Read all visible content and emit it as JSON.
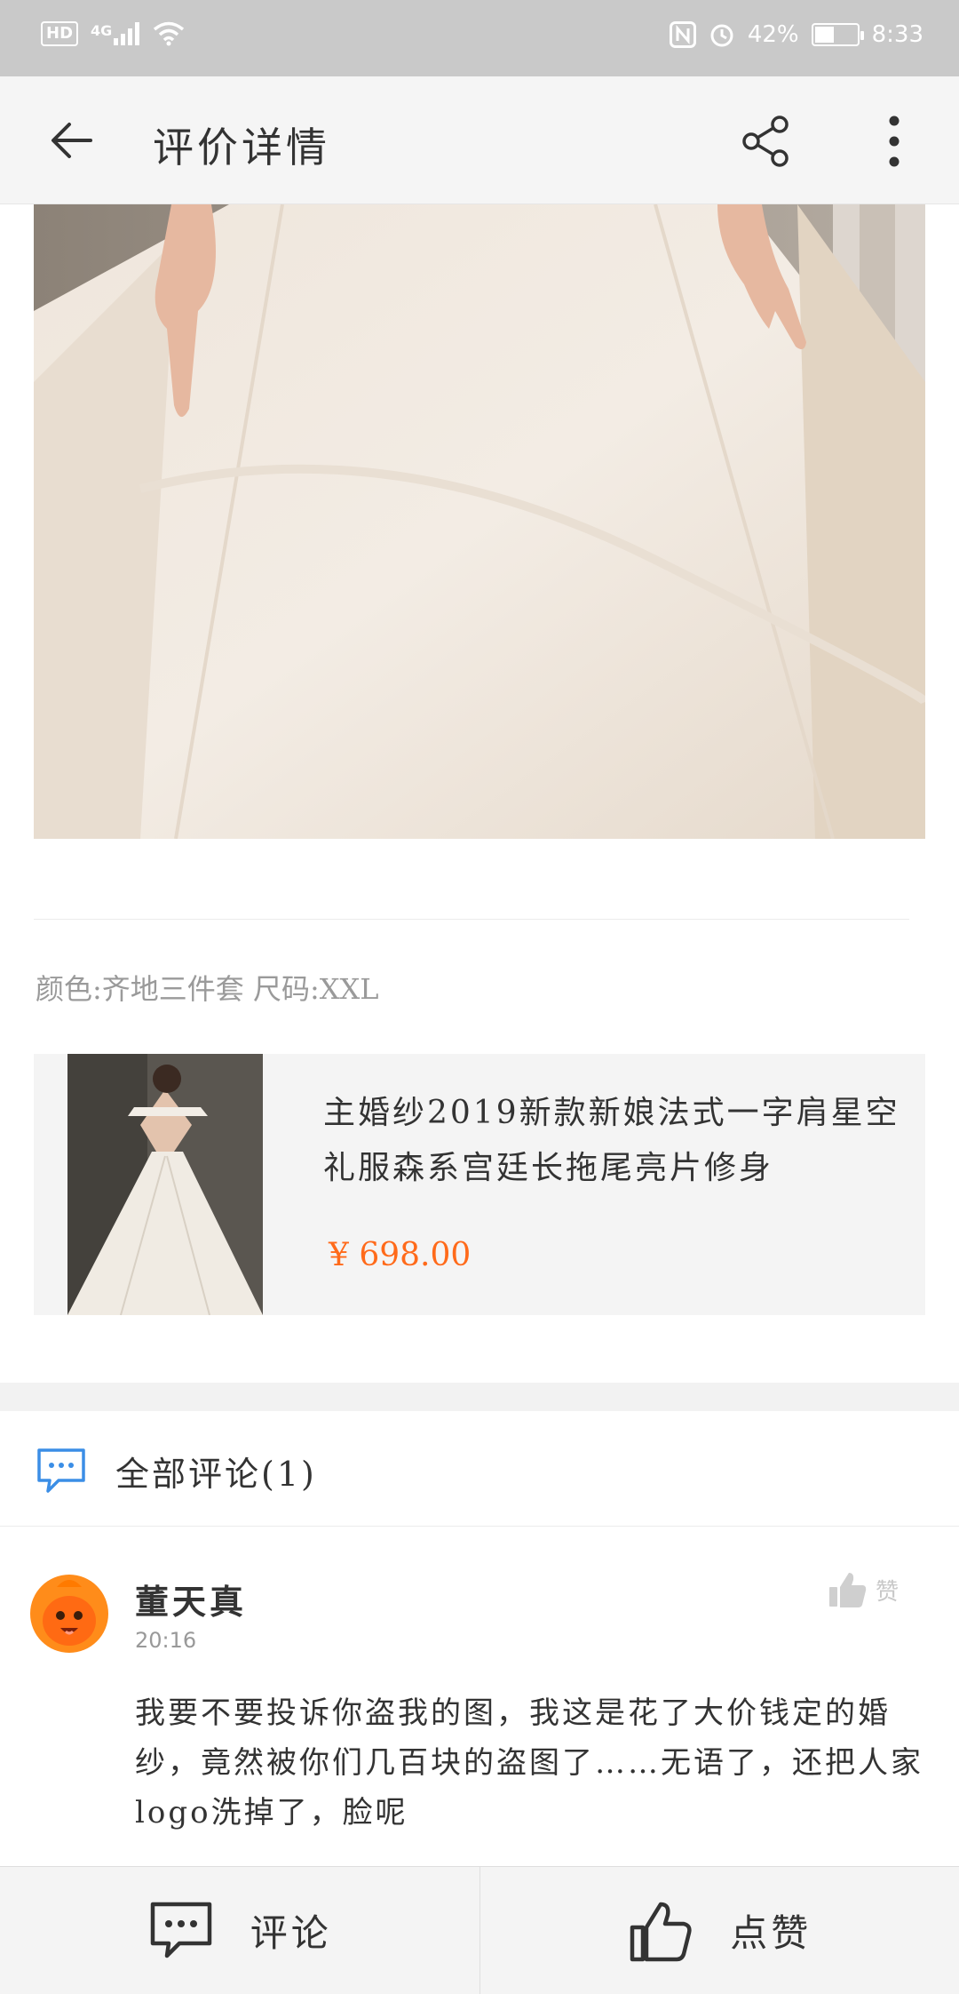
{
  "status_bar": {
    "hd": "HD",
    "network": "4G",
    "battery_text": "42%",
    "battery_level": 0.42,
    "time": "8:33"
  },
  "app_bar": {
    "title": "评价详情",
    "back_icon": "arrow-left-icon",
    "share_icon": "share-icon",
    "more_icon": "more-vertical-icon"
  },
  "review": {
    "spec": "颜色:齐地三件套 尺码:XXL"
  },
  "product": {
    "title": "主婚纱2019新款新娘法式一字肩星空礼服森系宫廷长拖尾亮片修身",
    "price": "¥ 698.00",
    "price_color": "#ff6a1a"
  },
  "comments": {
    "header": "全部评论(1)",
    "items": [
      {
        "author": "董天真",
        "time": "20:16",
        "like_label": "赞",
        "text": "我要不要投诉你盗我的图，我这是花了大价钱定的婚纱，竟然被你们几百块的盗图了……无语了，还把人家logo洗掉了，脸呢"
      }
    ]
  },
  "bottom_bar": {
    "comment_label": "评论",
    "like_label": "点赞"
  }
}
